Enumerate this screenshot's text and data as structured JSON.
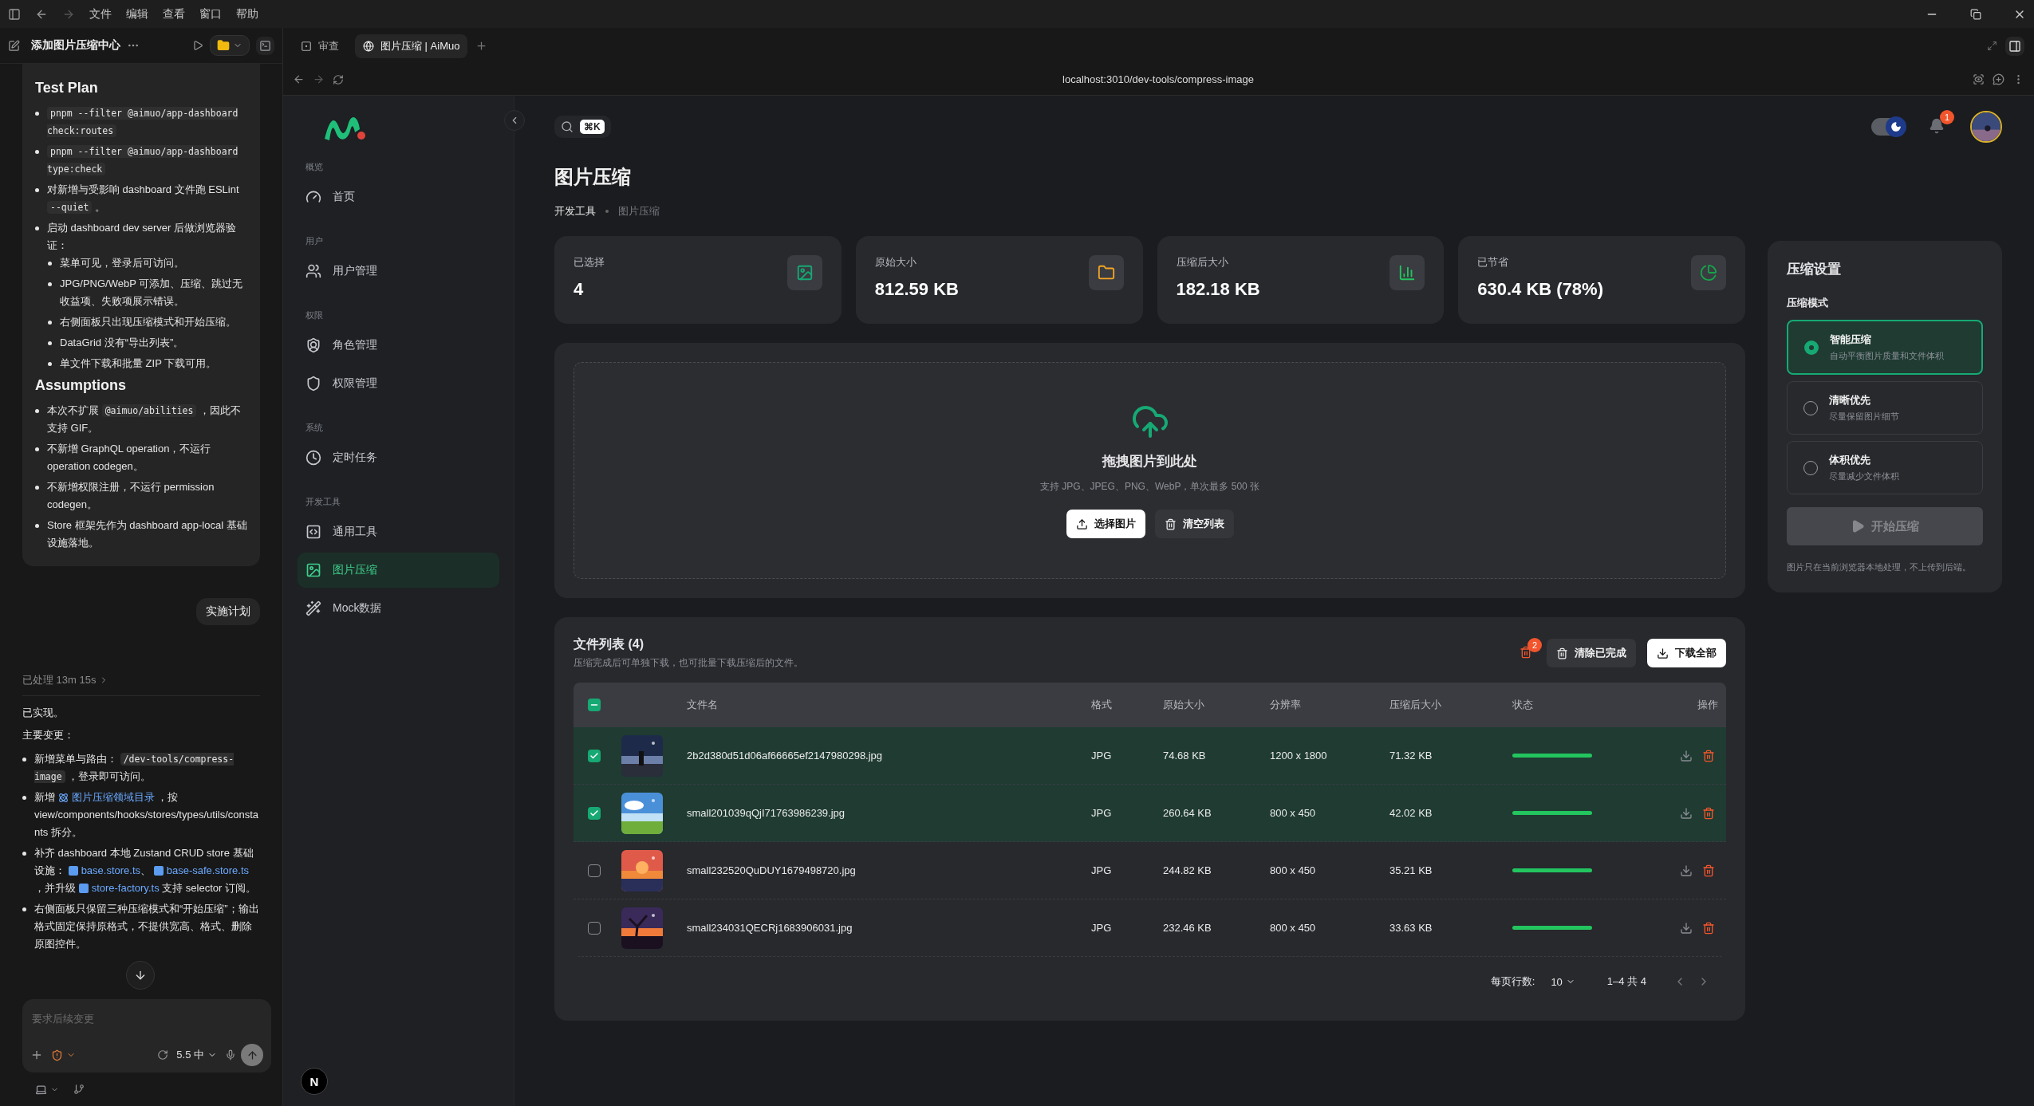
{
  "menubar": {
    "items": [
      "文件",
      "编辑",
      "查看",
      "窗口",
      "帮助"
    ]
  },
  "chat": {
    "title": "添加图片压缩中心",
    "plan": [
      {
        "heading": "Test Plan",
        "items": [
          {
            "parts": [
              {
                "kind": "code",
                "text": "pnpm --filter @aimuo/app-dashboard check:routes"
              }
            ]
          },
          {
            "parts": [
              {
                "kind": "code",
                "text": "pnpm --filter @aimuo/app-dashboard type:check"
              }
            ]
          },
          {
            "parts": [
              {
                "kind": "text",
                "text": "对新增与受影响 dashboard 文件跑 ESLint "
              },
              {
                "kind": "code",
                "text": "--quiet"
              },
              {
                "kind": "text",
                "text": " 。"
              }
            ]
          },
          {
            "parts": [
              {
                "kind": "text",
                "text": "启动 dashboard dev server 后做浏览器验证："
              }
            ],
            "children": [
              {
                "parts": [
                  {
                    "kind": "text",
                    "text": "菜单可见，登录后可访问。"
                  }
                ]
              },
              {
                "parts": [
                  {
                    "kind": "text",
                    "text": "JPG/PNG/WebP 可添加、压缩、跳过无收益项、失败项展示错误。"
                  }
                ]
              },
              {
                "parts": [
                  {
                    "kind": "text",
                    "text": "右侧面板只出现压缩模式和开始压缩。"
                  }
                ]
              },
              {
                "parts": [
                  {
                    "kind": "text",
                    "text": "DataGrid 没有“导出列表”。"
                  }
                ]
              },
              {
                "parts": [
                  {
                    "kind": "text",
                    "text": "单文件下载和批量 ZIP 下载可用。"
                  }
                ]
              }
            ]
          }
        ]
      },
      {
        "heading": "Assumptions",
        "items": [
          {
            "parts": [
              {
                "kind": "text",
                "text": "本次不扩展 "
              },
              {
                "kind": "code",
                "text": "@aimuo/abilities"
              },
              {
                "kind": "text",
                "text": " ，因此不支持 GIF。"
              }
            ]
          },
          {
            "parts": [
              {
                "kind": "text",
                "text": "不新增 GraphQL operation，不运行 operation codegen。"
              }
            ]
          },
          {
            "parts": [
              {
                "kind": "text",
                "text": "不新增权限注册，不运行 permission codegen。"
              }
            ]
          },
          {
            "parts": [
              {
                "kind": "text",
                "text": "Store 框架先作为 dashboard app-local 基础设施落地。"
              }
            ]
          }
        ]
      }
    ],
    "user_message": "实施计划",
    "processed": "已处理 13m 15s",
    "reply_paragraphs": [
      "已实现。",
      "主要变更："
    ],
    "reply_items": [
      {
        "parts": [
          {
            "kind": "text",
            "text": "新增菜单与路由： "
          },
          {
            "kind": "code",
            "text": "/dev-tools/compress-image"
          },
          {
            "kind": "text",
            "text": " ，登录即可访问。"
          }
        ]
      },
      {
        "parts": [
          {
            "kind": "text",
            "text": "新增 "
          },
          {
            "kind": "link",
            "text": "图片压缩领域目录"
          },
          {
            "kind": "text",
            "text": " ，按 view/components/hooks/stores/types/utils/constants 拆分。"
          }
        ]
      },
      {
        "parts": [
          {
            "kind": "text",
            "text": "补齐 dashboard 本地 Zustand CRUD store 基础设施： "
          },
          {
            "kind": "file",
            "text": "base.store.ts"
          },
          {
            "kind": "text",
            "text": "、 "
          },
          {
            "kind": "file",
            "text": "base-safe.store.ts"
          },
          {
            "kind": "text",
            "text": " ，并升级 "
          },
          {
            "kind": "file",
            "text": "store-factory.ts"
          },
          {
            "kind": "text",
            "text": " 支持 selector 订阅。"
          }
        ]
      },
      {
        "parts": [
          {
            "kind": "text",
            "text": "右侧面板只保留三种压缩模式和“开始压缩”；输出格式固定保持原格式，不提供宽高、格式、删除原图控件。"
          }
        ]
      }
    ],
    "composer": {
      "placeholder": "要求后续变更",
      "model": "5.5 中"
    }
  },
  "browser": {
    "tabs": [
      {
        "label": "审查",
        "selected": false
      },
      {
        "label": "图片压缩 | AiMuo",
        "selected": true
      }
    ],
    "url": "localhost:3010/dev-tools/compress-image",
    "dev_indicator": "N"
  },
  "sidebar": {
    "groups": [
      {
        "label": "概览",
        "items": [
          {
            "label": "首页",
            "selected": false
          }
        ]
      },
      {
        "label": "用户",
        "items": [
          {
            "label": "用户管理",
            "selected": false
          }
        ]
      },
      {
        "label": "权限",
        "items": [
          {
            "label": "角色管理",
            "selected": false
          },
          {
            "label": "权限管理",
            "selected": false
          }
        ]
      },
      {
        "label": "系统",
        "items": [
          {
            "label": "定时任务",
            "selected": false
          }
        ]
      },
      {
        "label": "开发工具",
        "items": [
          {
            "label": "通用工具",
            "selected": false
          },
          {
            "label": "图片压缩",
            "selected": true
          },
          {
            "label": "Mock数据",
            "selected": false
          }
        ]
      }
    ]
  },
  "header": {
    "search_shortcut": "⌘K",
    "dark_mode": true,
    "notification_count": "1"
  },
  "page": {
    "title": "图片压缩",
    "breadcrumb": [
      "开发工具",
      "图片压缩"
    ]
  },
  "stats": [
    {
      "label": "已选择",
      "value": "4"
    },
    {
      "label": "原始大小",
      "value": "812.59 KB"
    },
    {
      "label": "压缩后大小",
      "value": "182.18 KB"
    },
    {
      "label": "已节省",
      "value": "630.4 KB (78%)"
    }
  ],
  "upload": {
    "title": "拖拽图片到此处",
    "hint": "支持 JPG、JPEG、PNG、WebP，单次最多 500 张",
    "select_button": "选择图片",
    "clear_button": "清空列表"
  },
  "file_list": {
    "title": "文件列表 (4)",
    "subtitle": "压缩完成后可单独下载，也可批量下载压缩后的文件。",
    "delete_count": "2",
    "clear_done_button": "清除已完成",
    "download_all_button": "下载全部",
    "select_all": {
      "partial": true
    },
    "columns": [
      "文件名",
      "格式",
      "原始大小",
      "分辨率",
      "压缩后大小",
      "状态",
      "操作"
    ],
    "rows": [
      {
        "selected": true,
        "name": "2b2d380d51d06af66665ef2147980298.jpg",
        "format": "JPG",
        "original": "74.68 KB",
        "resolution": "1200 x 1800",
        "compressed": "71.32 KB",
        "level": 1
      },
      {
        "selected": true,
        "name": "small201039qQjI71763986239.jpg",
        "format": "JPG",
        "original": "260.64 KB",
        "resolution": "800 x 450",
        "compressed": "42.02 KB",
        "level": 1
      },
      {
        "selected": false,
        "name": "small232520QuDUY1679498720.jpg",
        "format": "JPG",
        "original": "244.82 KB",
        "resolution": "800 x 450",
        "compressed": "35.21 KB",
        "level": 1
      },
      {
        "selected": false,
        "name": "small234031QECRj1683906031.jpg",
        "format": "JPG",
        "original": "232.46 KB",
        "resolution": "800 x 450",
        "compressed": "33.63 KB",
        "level": 1
      }
    ],
    "rows_per_page_label": "每页行数:",
    "rows_per_page": "10",
    "range": "1–4 共 4"
  },
  "settings": {
    "title": "压缩设置",
    "section": "压缩模式",
    "options": [
      {
        "title": "智能压缩",
        "description": "自动平衡图片质量和文件体积",
        "selected": true
      },
      {
        "title": "清晰优先",
        "description": "尽量保留图片细节",
        "selected": false
      },
      {
        "title": "体积优先",
        "description": "尽量减少文件体积",
        "selected": false
      }
    ],
    "start_button": "开始压缩",
    "start_disabled": true,
    "note": "图片只在当前浏览器本地处理，不上传到后端。"
  }
}
